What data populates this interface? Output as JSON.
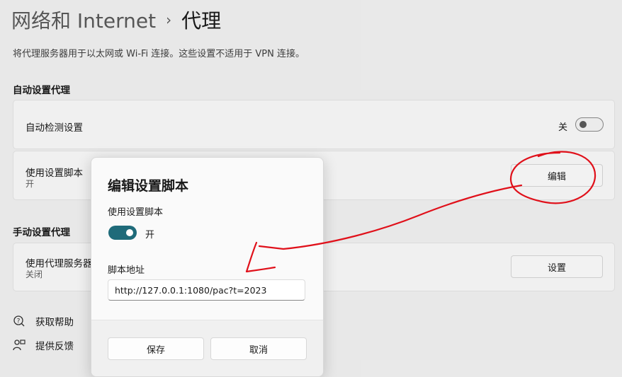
{
  "breadcrumb": {
    "parent": "网络和 Internet",
    "separator": "›",
    "current": "代理"
  },
  "description": "将代理服务器用于以太网或 Wi-Fi 连接。这些设置不适用于 VPN 连接。",
  "auto_section": {
    "heading": "自动设置代理",
    "detect": {
      "title": "自动检测设置",
      "state": "关"
    },
    "script": {
      "title": "使用设置脚本",
      "state": "开",
      "edit_label": "编辑"
    }
  },
  "manual_section": {
    "heading": "手动设置代理",
    "proxy": {
      "title": "使用代理服务器",
      "state": "关闭",
      "setup_label": "设置"
    }
  },
  "links": {
    "help": "获取帮助",
    "feedback": "提供反馈"
  },
  "dialog": {
    "title": "编辑设置脚本",
    "use_script_label": "使用设置脚本",
    "toggle_text": "开",
    "address_label": "脚本地址",
    "address_value": "http://127.0.0.1:1080/pac?t=2023",
    "save_label": "保存",
    "cancel_label": "取消"
  },
  "colors": {
    "accent": "#1f6b7a",
    "annotation": "#e0101a"
  },
  "icons": {
    "help": "help-icon",
    "feedback": "feedback-icon",
    "chevron": "chevron-right-icon"
  }
}
